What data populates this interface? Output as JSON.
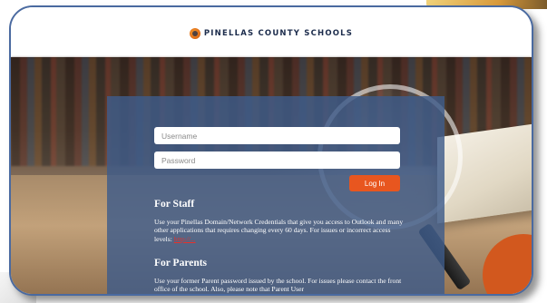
{
  "header": {
    "brand_text": "PINELLAS COUNTY SCHOOLS"
  },
  "login": {
    "username_placeholder": "Username",
    "password_placeholder": "Password",
    "login_label": "Log In"
  },
  "staff": {
    "title": "For Staff",
    "body": "Use your Pinellas Domain/Network Credentials that give you access to Outlook and many other applications that requires changing every 60 days. For issues or incorrect access levels:",
    "link_text": "http://..."
  },
  "parents": {
    "title": "For Parents",
    "body": "Use your former Parent password issued by the school. For issues please contact the front office of the school. Also, please note that Parent User"
  },
  "colors": {
    "panel": "#3e5c8a",
    "button": "#e8561f",
    "frame_border": "#4a6aa0",
    "brand_text": "#1c2c4c"
  },
  "icons": {
    "logo": "pcs-logo-icon"
  }
}
